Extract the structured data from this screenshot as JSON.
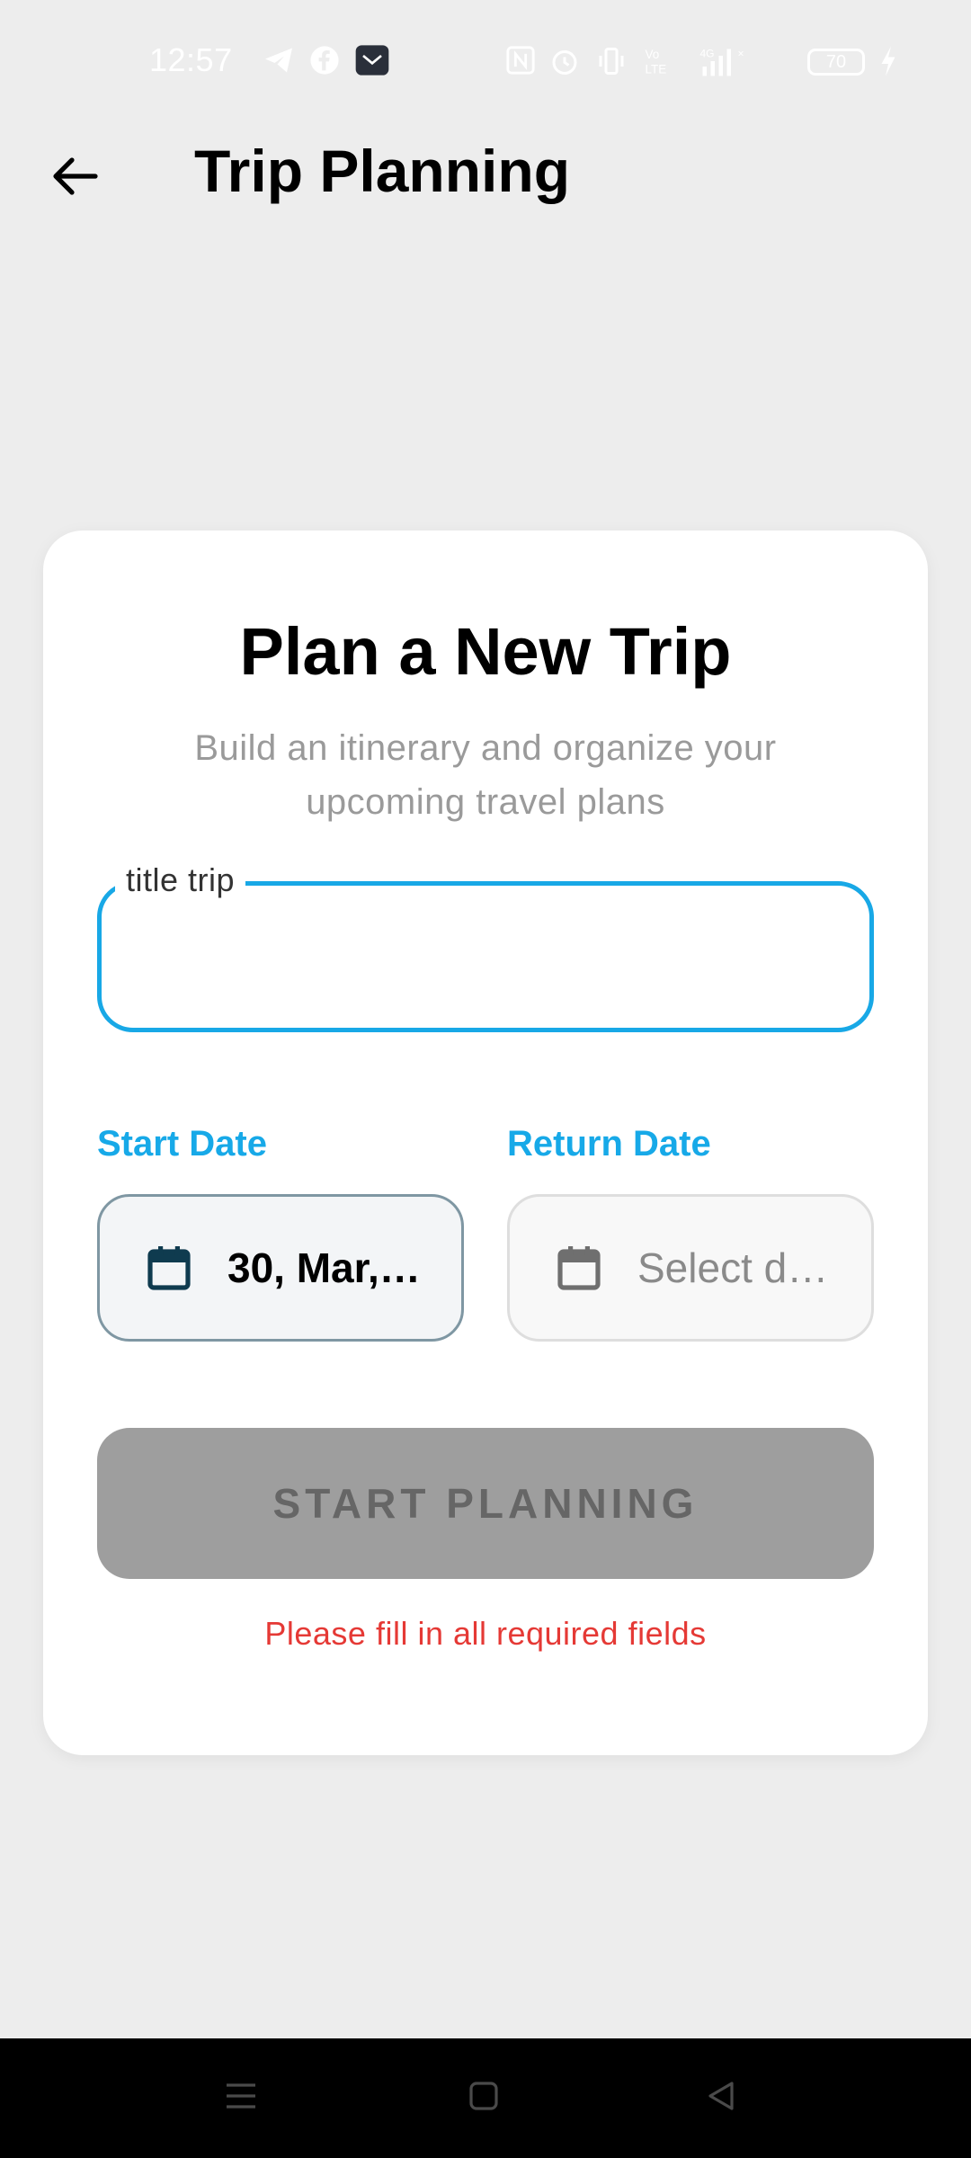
{
  "status_bar": {
    "time": "12:57",
    "battery": "70"
  },
  "app_bar": {
    "title": "Trip Planning"
  },
  "card": {
    "title": "Plan a New Trip",
    "subtitle": "Build an itinerary and organize your upcoming travel plans",
    "title_field": {
      "label": "title trip",
      "value": ""
    },
    "start_date": {
      "label": "Start Date",
      "value": "30, Mar, …"
    },
    "return_date": {
      "label": "Return Date",
      "placeholder": "Select d…"
    },
    "start_button_label": "START PLANNING",
    "error_message": "Please fill in all required fields"
  },
  "colors": {
    "accent": "#17a9e8",
    "error": "#e53935",
    "disabled_button": "#9e9e9e",
    "background": "#ededed"
  },
  "icons": [
    "telegram-icon",
    "facebook-icon",
    "mail-app-icon",
    "nfc-icon",
    "alarm-icon",
    "vibrate-icon",
    "volte-icon",
    "signal-icon",
    "battery-icon",
    "charging-icon",
    "back-arrow-icon",
    "calendar-icon",
    "menu-icon",
    "home-icon",
    "back-icon"
  ]
}
